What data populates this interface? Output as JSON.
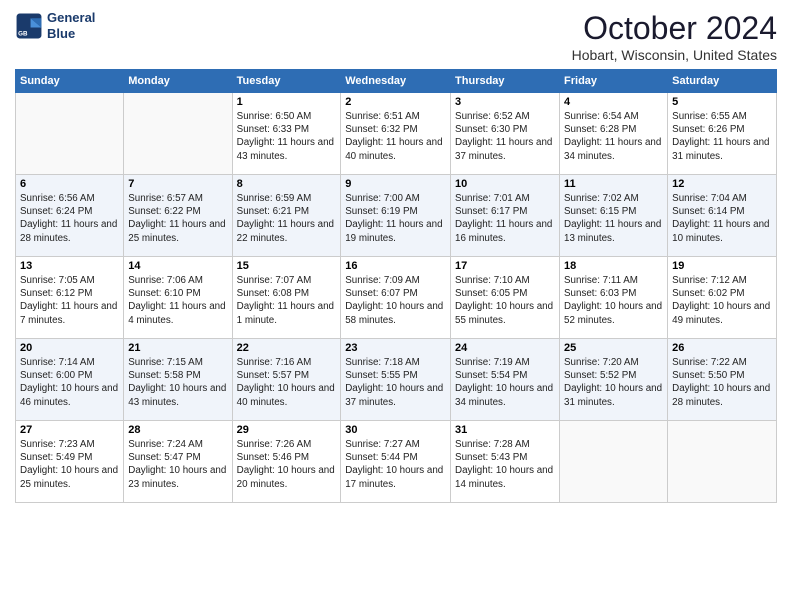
{
  "header": {
    "logo_line1": "General",
    "logo_line2": "Blue",
    "month": "October 2024",
    "location": "Hobart, Wisconsin, United States"
  },
  "weekdays": [
    "Sunday",
    "Monday",
    "Tuesday",
    "Wednesday",
    "Thursday",
    "Friday",
    "Saturday"
  ],
  "weeks": [
    [
      {
        "day": "",
        "info": ""
      },
      {
        "day": "",
        "info": ""
      },
      {
        "day": "1",
        "info": "Sunrise: 6:50 AM\nSunset: 6:33 PM\nDaylight: 11 hours and 43 minutes."
      },
      {
        "day": "2",
        "info": "Sunrise: 6:51 AM\nSunset: 6:32 PM\nDaylight: 11 hours and 40 minutes."
      },
      {
        "day": "3",
        "info": "Sunrise: 6:52 AM\nSunset: 6:30 PM\nDaylight: 11 hours and 37 minutes."
      },
      {
        "day": "4",
        "info": "Sunrise: 6:54 AM\nSunset: 6:28 PM\nDaylight: 11 hours and 34 minutes."
      },
      {
        "day": "5",
        "info": "Sunrise: 6:55 AM\nSunset: 6:26 PM\nDaylight: 11 hours and 31 minutes."
      }
    ],
    [
      {
        "day": "6",
        "info": "Sunrise: 6:56 AM\nSunset: 6:24 PM\nDaylight: 11 hours and 28 minutes."
      },
      {
        "day": "7",
        "info": "Sunrise: 6:57 AM\nSunset: 6:22 PM\nDaylight: 11 hours and 25 minutes."
      },
      {
        "day": "8",
        "info": "Sunrise: 6:59 AM\nSunset: 6:21 PM\nDaylight: 11 hours and 22 minutes."
      },
      {
        "day": "9",
        "info": "Sunrise: 7:00 AM\nSunset: 6:19 PM\nDaylight: 11 hours and 19 minutes."
      },
      {
        "day": "10",
        "info": "Sunrise: 7:01 AM\nSunset: 6:17 PM\nDaylight: 11 hours and 16 minutes."
      },
      {
        "day": "11",
        "info": "Sunrise: 7:02 AM\nSunset: 6:15 PM\nDaylight: 11 hours and 13 minutes."
      },
      {
        "day": "12",
        "info": "Sunrise: 7:04 AM\nSunset: 6:14 PM\nDaylight: 11 hours and 10 minutes."
      }
    ],
    [
      {
        "day": "13",
        "info": "Sunrise: 7:05 AM\nSunset: 6:12 PM\nDaylight: 11 hours and 7 minutes."
      },
      {
        "day": "14",
        "info": "Sunrise: 7:06 AM\nSunset: 6:10 PM\nDaylight: 11 hours and 4 minutes."
      },
      {
        "day": "15",
        "info": "Sunrise: 7:07 AM\nSunset: 6:08 PM\nDaylight: 11 hours and 1 minute."
      },
      {
        "day": "16",
        "info": "Sunrise: 7:09 AM\nSunset: 6:07 PM\nDaylight: 10 hours and 58 minutes."
      },
      {
        "day": "17",
        "info": "Sunrise: 7:10 AM\nSunset: 6:05 PM\nDaylight: 10 hours and 55 minutes."
      },
      {
        "day": "18",
        "info": "Sunrise: 7:11 AM\nSunset: 6:03 PM\nDaylight: 10 hours and 52 minutes."
      },
      {
        "day": "19",
        "info": "Sunrise: 7:12 AM\nSunset: 6:02 PM\nDaylight: 10 hours and 49 minutes."
      }
    ],
    [
      {
        "day": "20",
        "info": "Sunrise: 7:14 AM\nSunset: 6:00 PM\nDaylight: 10 hours and 46 minutes."
      },
      {
        "day": "21",
        "info": "Sunrise: 7:15 AM\nSunset: 5:58 PM\nDaylight: 10 hours and 43 minutes."
      },
      {
        "day": "22",
        "info": "Sunrise: 7:16 AM\nSunset: 5:57 PM\nDaylight: 10 hours and 40 minutes."
      },
      {
        "day": "23",
        "info": "Sunrise: 7:18 AM\nSunset: 5:55 PM\nDaylight: 10 hours and 37 minutes."
      },
      {
        "day": "24",
        "info": "Sunrise: 7:19 AM\nSunset: 5:54 PM\nDaylight: 10 hours and 34 minutes."
      },
      {
        "day": "25",
        "info": "Sunrise: 7:20 AM\nSunset: 5:52 PM\nDaylight: 10 hours and 31 minutes."
      },
      {
        "day": "26",
        "info": "Sunrise: 7:22 AM\nSunset: 5:50 PM\nDaylight: 10 hours and 28 minutes."
      }
    ],
    [
      {
        "day": "27",
        "info": "Sunrise: 7:23 AM\nSunset: 5:49 PM\nDaylight: 10 hours and 25 minutes."
      },
      {
        "day": "28",
        "info": "Sunrise: 7:24 AM\nSunset: 5:47 PM\nDaylight: 10 hours and 23 minutes."
      },
      {
        "day": "29",
        "info": "Sunrise: 7:26 AM\nSunset: 5:46 PM\nDaylight: 10 hours and 20 minutes."
      },
      {
        "day": "30",
        "info": "Sunrise: 7:27 AM\nSunset: 5:44 PM\nDaylight: 10 hours and 17 minutes."
      },
      {
        "day": "31",
        "info": "Sunrise: 7:28 AM\nSunset: 5:43 PM\nDaylight: 10 hours and 14 minutes."
      },
      {
        "day": "",
        "info": ""
      },
      {
        "day": "",
        "info": ""
      }
    ]
  ]
}
